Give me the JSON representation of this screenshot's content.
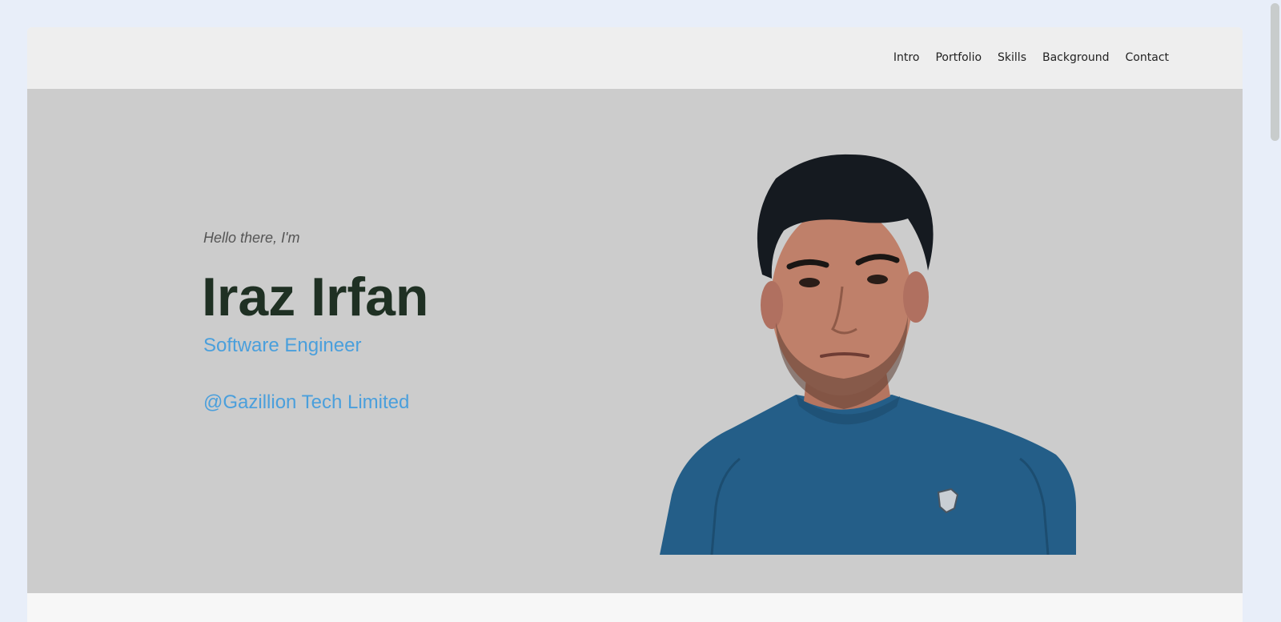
{
  "nav": {
    "links": [
      "Intro",
      "Portfolio",
      "Skills",
      "Background",
      "Contact"
    ]
  },
  "hero": {
    "greeting": "Hello there, I'm",
    "name": "Iraz Irfan",
    "role": "Software Engineer",
    "company": "@Gazillion Tech Limited"
  },
  "colors": {
    "page_bg": "#e8eef9",
    "nav_bg": "#eeeeee",
    "hero_bg": "#cccccc",
    "name_color": "#1f3023",
    "accent": "#4a9fdc"
  },
  "icons": {
    "portrait": "person-photo"
  }
}
